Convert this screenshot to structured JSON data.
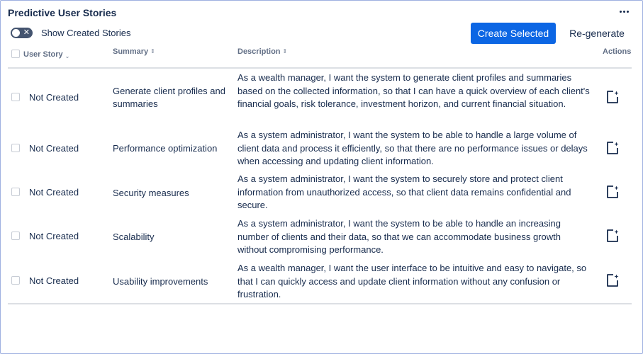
{
  "panel": {
    "title": "Predictive User Stories",
    "more_icon": "more-horizontal-icon"
  },
  "toolbar": {
    "toggle_label": "Show Created Stories",
    "toggle_on": false,
    "create_label": "Create Selected",
    "regenerate_label": "Re-generate"
  },
  "table": {
    "headers": {
      "user_story": "User Story",
      "summary": "Summary",
      "description": "Description",
      "actions": "Actions"
    },
    "rows": [
      {
        "status": "Not Created",
        "summary": "Generate client profiles and summaries",
        "description": "As a wealth manager, I want the system to generate client profiles and summaries based on the collected information, so that I can have a quick overview of each client's financial goals, risk tolerance, investment horizon, and current financial situation.",
        "action_icon": "create-story-icon"
      },
      {
        "status": "Not Created",
        "summary": "Performance optimization",
        "description": "As a system administrator, I want the system to be able to handle a large volume of client data and process it efficiently, so that there are no performance issues or delays when accessing and updating client information.",
        "action_icon": "create-story-icon"
      },
      {
        "status": "Not Created",
        "summary": "Security measures",
        "description": "As a system administrator, I want the system to securely store and protect client information from unauthorized access, so that client data remains confidential and secure.",
        "action_icon": "create-story-icon"
      },
      {
        "status": "Not Created",
        "summary": "Scalability",
        "description": "As a system administrator, I want the system to be able to handle an increasing number of clients and their data, so that we can accommodate business growth without compromising performance.",
        "action_icon": "create-story-icon"
      },
      {
        "status": "Not Created",
        "summary": "Usability improvements",
        "description": "As a wealth manager, I want the user interface to be intuitive and easy to navigate, so that I can quickly access and update client information without any confusion or frustration.",
        "action_icon": "create-story-icon"
      }
    ]
  },
  "colors": {
    "primary": "#0c66e4",
    "text": "#172b4d",
    "muted": "#626f86",
    "border": "#9fb0e0"
  }
}
